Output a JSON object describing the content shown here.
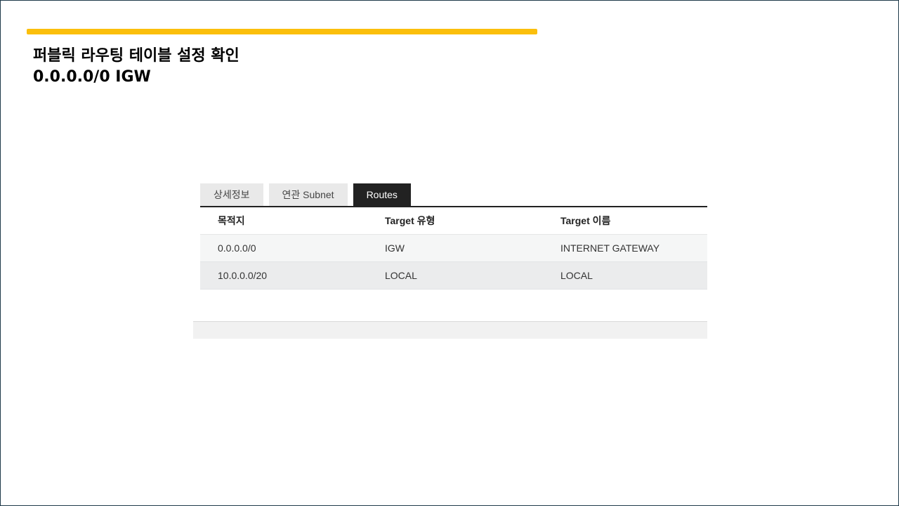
{
  "title": {
    "line1": "퍼블릭 라우팅 테이블 설정 확인",
    "line2": "0.0.0.0/0 IGW"
  },
  "tabs": [
    {
      "label": "상세정보",
      "active": false
    },
    {
      "label": "연관 Subnet",
      "active": false
    },
    {
      "label": "Routes",
      "active": true
    }
  ],
  "table": {
    "headers": [
      "목적지",
      "Target 유형",
      "Target 이름"
    ],
    "rows": [
      [
        "0.0.0.0/0",
        "IGW",
        "INTERNET GATEWAY"
      ],
      [
        "10.0.0.0/20",
        "LOCAL",
        "LOCAL"
      ]
    ]
  },
  "colors": {
    "accent": "#fbbf0c",
    "active_tab": "#222222"
  }
}
